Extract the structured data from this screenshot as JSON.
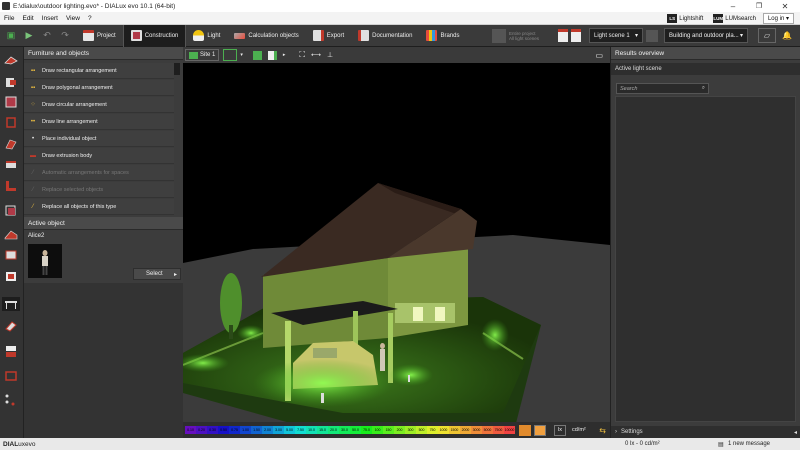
{
  "window": {
    "title": "E:\\dialux\\outdoor lighting.evo* - DIALux evo 10.1  (64-bit)",
    "minimize": "–",
    "maximize": "❐",
    "close": "✕"
  },
  "menubar": {
    "items": [
      "File",
      "Edit",
      "Insert",
      "View",
      "?"
    ],
    "lightshift": "Lightshift",
    "lumsearch": "LUMsearch",
    "login": "Log in ▾",
    "lightshift_icon": "LS",
    "lumsearch_icon": "LUM"
  },
  "ribbon": {
    "tabs": [
      "Project",
      "Construction",
      "Light",
      "Calculation objects",
      "Export",
      "Documentation",
      "Brands"
    ],
    "active_tab": "Construction",
    "entire_project": "Entire project",
    "all_light_scenes": "All light scenes",
    "light_scene": "Light scene 1",
    "view_mode": "Building and outdoor pla..."
  },
  "left_panel": {
    "title": "Furniture and objects",
    "items": [
      {
        "label": "Draw rectangular arrangement",
        "enabled": true
      },
      {
        "label": "Draw polygonal arrangement",
        "enabled": true
      },
      {
        "label": "Draw circular arrangement",
        "enabled": true
      },
      {
        "label": "Draw line arrangement",
        "enabled": true
      },
      {
        "label": "Place individual object",
        "enabled": true
      },
      {
        "label": "Draw extrusion body",
        "enabled": true
      },
      {
        "label": "Automatic arrangements for spaces",
        "enabled": false
      },
      {
        "label": "Replace selected objects",
        "enabled": false
      },
      {
        "label": "Replace all objects of this type",
        "enabled": true
      }
    ],
    "active_object_title": "Active object",
    "active_object_name": "Alice2",
    "select_label": "Select"
  },
  "viewport": {
    "site_label": "Site 1",
    "legend": [
      "0.10",
      "0.20",
      "0.30",
      "0.50",
      "0.75",
      "1.00",
      "1.50",
      "2.00",
      "3.00",
      "5.00",
      "7.50",
      "10.0",
      "15.0",
      "20.0",
      "30.0",
      "50.0",
      "75.0",
      "100",
      "150",
      "200",
      "300",
      "500",
      "750",
      "1000",
      "1500",
      "2000",
      "3000",
      "5000",
      "7500",
      "10000"
    ],
    "unit_lx": "lx",
    "unit_cd": "cd/m²"
  },
  "right_panel": {
    "title": "Results overview",
    "subtitle": "Active light scene",
    "search_placeholder": "Search",
    "settings_label": "Settings"
  },
  "statusbar": {
    "brand_a": "DIAL",
    "brand_b": "ux",
    "brand_c": "evo",
    "values": "0 lx - 0 cd/m²",
    "messages": "1 new message"
  },
  "colors": {
    "accent_green": "#46c23a",
    "ribbon_bg": "#3a3a3a",
    "panel_bg": "#3c3c3c"
  }
}
